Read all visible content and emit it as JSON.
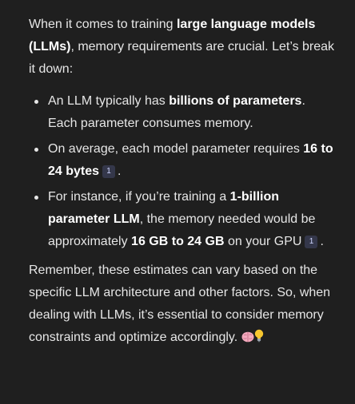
{
  "intro": {
    "t1": "When it comes to training ",
    "b1": "large language models (LLMs)",
    "t2": ", memory requirements are crucial. Let’s break it down:"
  },
  "bullets": [
    {
      "t1": "An LLM typically has ",
      "b1": "billions of parameters",
      "t2": ". Each parameter consumes memory."
    },
    {
      "t1": "On average, each model parameter requires ",
      "b1": "16 to 24 bytes",
      "cite": "1",
      "t2": "."
    },
    {
      "t1": "For instance, if you’re training a ",
      "b1": "1-billion parameter LLM",
      "t2": ", the memory needed would be approximately ",
      "b2": "16 GB to 24 GB",
      "t3": " on your GPU",
      "cite": "1",
      "t4": "."
    }
  ],
  "outro": {
    "text": "Remember, these estimates can vary based on the specific LLM architecture and other factors. So, when dealing with LLMs, it’s essential to consider memory constraints and optimize accordingly."
  },
  "icons": [
    "brain-emoji-icon",
    "lightbulb-emoji-icon"
  ],
  "colors": {
    "background": "#1f1f1f",
    "text": "#e6e6e6",
    "bold": "#ffffff",
    "citation_bg": "#34374a",
    "citation_text": "#cfd6ff"
  }
}
